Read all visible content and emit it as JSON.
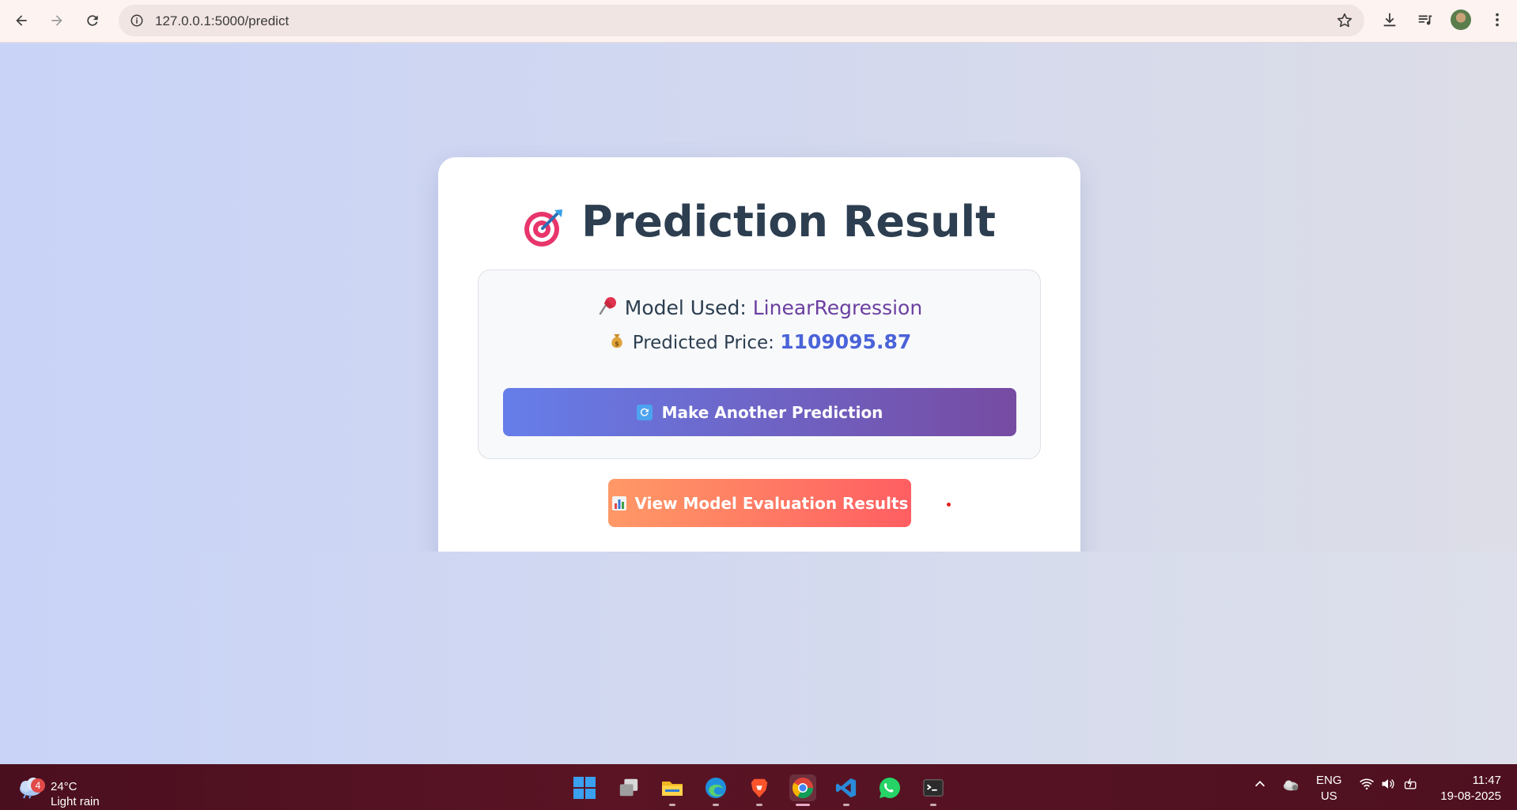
{
  "browser": {
    "url": "127.0.0.1:5000/predict"
  },
  "result": {
    "title": "Prediction Result",
    "model_label": "Model Used:",
    "model_value": "LinearRegression",
    "price_label": "Predicted Price:",
    "price_value": "1109095.87",
    "again_button": "Make Another Prediction",
    "eval_button": "View Model Evaluation Results"
  },
  "taskbar": {
    "weather_badge": "4",
    "temperature": "24°C",
    "condition": "Light rain",
    "lang_top": "ENG",
    "lang_bottom": "US",
    "time": "11:47",
    "date": "19-08-2025"
  },
  "colors": {
    "again_gradient": [
      "#667eea",
      "#764ba2"
    ],
    "eval_gradient": [
      "#ff9966",
      "#ff5e62"
    ],
    "title": "#2c3e50",
    "model_value": "#6b3fa0",
    "price_value": "#4a63d8"
  },
  "icons": {
    "title": "target-dart-icon",
    "model": "pushpin-icon",
    "price": "money-bag-icon",
    "again": "refresh-icon",
    "eval": "bar-chart-icon"
  }
}
